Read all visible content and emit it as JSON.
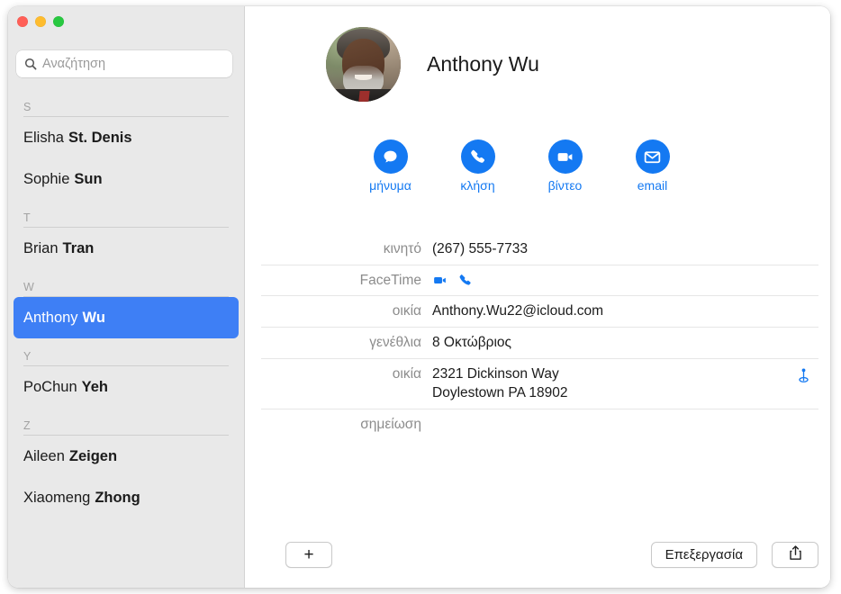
{
  "window": {
    "traffic_lights": [
      {
        "name": "close",
        "color": "#ff5f57"
      },
      {
        "name": "minimize",
        "color": "#febc2e"
      },
      {
        "name": "zoom",
        "color": "#28c840"
      }
    ]
  },
  "sidebar": {
    "search": {
      "placeholder": "Αναζήτηση",
      "value": "",
      "icon": "search-icon"
    },
    "sections": [
      {
        "letter": "S",
        "contacts": [
          {
            "first": "Elisha",
            "last": "St. Denis",
            "selected": false
          },
          {
            "first": "Sophie",
            "last": "Sun",
            "selected": false
          }
        ]
      },
      {
        "letter": "T",
        "contacts": [
          {
            "first": "Brian",
            "last": "Tran",
            "selected": false
          }
        ]
      },
      {
        "letter": "W",
        "contacts": [
          {
            "first": "Anthony",
            "last": "Wu",
            "selected": true
          }
        ]
      },
      {
        "letter": "Y",
        "contacts": [
          {
            "first": "PoChun",
            "last": "Yeh",
            "selected": false
          }
        ]
      },
      {
        "letter": "Z",
        "contacts": [
          {
            "first": "Aileen",
            "last": "Zeigen",
            "selected": false
          },
          {
            "first": "Xiaomeng",
            "last": "Zhong",
            "selected": false
          }
        ]
      }
    ]
  },
  "detail": {
    "avatar": "contact-photo",
    "name": "Anthony Wu",
    "actions": [
      {
        "label": "μήνυμα",
        "icon": "message-icon"
      },
      {
        "label": "κλήση",
        "icon": "phone-icon"
      },
      {
        "label": "βίντεο",
        "icon": "video-icon"
      },
      {
        "label": "email",
        "icon": "envelope-icon"
      }
    ],
    "fields": [
      {
        "label": "κινητό",
        "value": "(267) 555-7733",
        "type": "text"
      },
      {
        "label": "FaceTime",
        "value": "",
        "type": "icons",
        "icons": [
          "video-icon",
          "phone-icon"
        ]
      },
      {
        "label": "οικία",
        "value": "Anthony.Wu22@icloud.com",
        "type": "text"
      },
      {
        "label": "γενέθλια",
        "value": "8 Οκτώβριος",
        "type": "text"
      },
      {
        "label": "οικία",
        "value": "2321 Dickinson Way",
        "value2": "Doylestown PA 18902",
        "type": "address",
        "trailing_icon": "map-pin-icon"
      },
      {
        "label": "σημείωση",
        "value": "",
        "type": "note"
      }
    ]
  },
  "bottom_bar": {
    "add_label": "+",
    "edit_label": "Επεξεργασία",
    "share_icon": "share-icon"
  },
  "colors": {
    "accent": "#1479f2",
    "selection": "#3e7ff5",
    "sidebar_bg": "#e9e9e9",
    "label_gray": "#8c8c8c"
  }
}
